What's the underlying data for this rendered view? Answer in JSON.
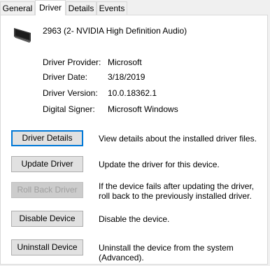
{
  "tabs": [
    {
      "label": "General",
      "active": false
    },
    {
      "label": "Driver",
      "active": true
    },
    {
      "label": "Details",
      "active": false
    },
    {
      "label": "Events",
      "active": false
    }
  ],
  "device": {
    "icon": "monitor-icon",
    "name": "2963 (2- NVIDIA High Definition Audio)"
  },
  "properties": [
    {
      "label": "Driver Provider:",
      "value": "Microsoft"
    },
    {
      "label": "Driver Date:",
      "value": "3/18/2019"
    },
    {
      "label": "Driver Version:",
      "value": "10.0.18362.1"
    },
    {
      "label": "Digital Signer:",
      "value": "Microsoft Windows"
    }
  ],
  "actions": [
    {
      "label": "Driver Details",
      "description": "View details about the installed driver files.",
      "enabled": true,
      "focused": true
    },
    {
      "label": "Update Driver",
      "description": "Update the driver for this device.",
      "enabled": true,
      "focused": false
    },
    {
      "label": "Roll Back Driver",
      "description": "If the device fails after updating the driver, roll back to the previously installed driver.",
      "enabled": false,
      "focused": false
    },
    {
      "label": "Disable Device",
      "description": "Disable the device.",
      "enabled": true,
      "focused": false
    },
    {
      "label": "Uninstall Device",
      "description": "Uninstall the device from the system (Advanced).",
      "enabled": true,
      "focused": false
    }
  ],
  "colors": {
    "focus": "#0078d7",
    "button_face": "#e1e1e1",
    "disabled_text": "#a0a0a0"
  }
}
